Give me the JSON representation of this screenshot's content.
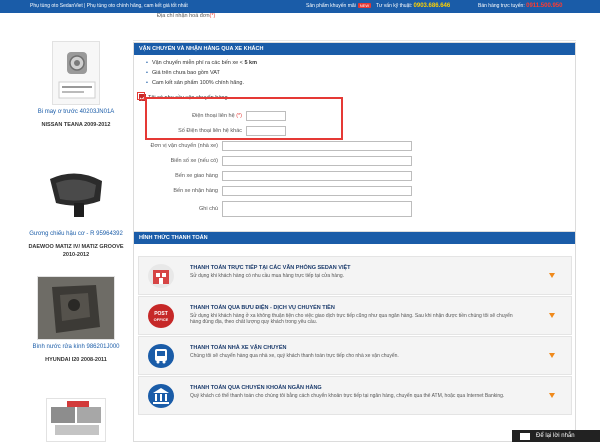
{
  "topbar": {
    "tagline": "Phụ tùng oto SedanViet | Phụ tùng oto chính hãng, cam kết giá tốt nhất",
    "promo_label": "Sản phẩm khuyến mãi",
    "new_badge": "NEW",
    "consult_label": "Tư vấn kỹ thuật:",
    "consult_phone": "0903.686.646",
    "sales_label": "Bán hàng trực tuyến:",
    "sales_phone": "0911.500.950"
  },
  "sidebar": {
    "products": [
      {
        "name": "Bi may ơ trước 40203JN01A",
        "car": "NISSAN TEANA 2009-2012"
      },
      {
        "name": "Gương chiếu hậu cơ - R 95964392",
        "car": "DAEWOO MATIZ IV/ MATIZ GROOVE 2010-2012"
      },
      {
        "name": "Bình nước rửa kính 986201J000",
        "car": "HYUNDAI I20 2008-2011"
      }
    ]
  },
  "form": {
    "top_field_label": "Địa chỉ nhận hoá đơn",
    "shipping_header": "VẬN CHUYỂN VÀ NHẬN HÀNG QUA XE KHÁCH",
    "bullets": [
      "Vận chuyển miễn phí ra các bến xe <",
      "Giá trên chưa bao gồm VAT",
      "Cam kết sản phẩm 100% chính hãng."
    ],
    "bullet_km": "5 km",
    "checkbox_label": "Tôi có nhu cầu vận chuyển hàng",
    "fields": [
      {
        "label": "Điện thoại liên hệ",
        "required": "(*)"
      },
      {
        "label": "Số Điện thoại liên hệ khác",
        "required": ""
      },
      {
        "label": "Đơn vị vận chuyển (nhà xe)",
        "required": ""
      },
      {
        "label": "Biển số xe (nếu có)",
        "required": ""
      },
      {
        "label": "Bến xe giao hàng",
        "required": ""
      },
      {
        "label": "Bến xe nhận hàng",
        "required": ""
      },
      {
        "label": "Ghi chú",
        "required": ""
      }
    ]
  },
  "payment": {
    "header": "HÌNH THỨC THANH TOÁN",
    "methods": [
      {
        "title": "THANH TOÁN TRỰC TIẾP TẠI CÁC VĂN PHÒNG SEDAN VIỆT",
        "desc": "Sử dụng khi khách hàng có nhu cầu mua hàng trực tiếp tại cửa hàng."
      },
      {
        "title": "THANH TOÁN QUA BƯU ĐIỆN - DỊCH VỤ CHUYỂN TIỀN",
        "desc": "Sử dụng khi khách hàng ở xa không thuận tiện cho việc giao dịch trực tiếp cũng như qua ngân hàng. Sau khi nhận được tiền chúng tôi sẽ chuyển hàng đúng địa, theo chất lượng quy khách trong yêu cầu."
      },
      {
        "title": "THANH TOÁN NHÀ XE VẬN CHUYỂN",
        "desc": "Chúng tôi sẽ chuyển hàng qua nhà xe, quý khách thanh toán trực tiếp cho nhà xe vận chuyển."
      },
      {
        "title": "THANH TOÁN QUA CHUYỂN KHOẢN NGÂN HÀNG",
        "desc": "Quý khách có thể thanh toán cho chúng tôi bằng cách chuyển khoản trực tiếp tại ngân hàng, chuyển qua thẻ ATM, hoặc qua Internet Banking."
      }
    ]
  },
  "chat": {
    "label": "Để lại lời nhắn"
  },
  "colors": {
    "primary": "#1a5ca8",
    "accent": "#f08a1c",
    "highlight": "#e53935"
  }
}
